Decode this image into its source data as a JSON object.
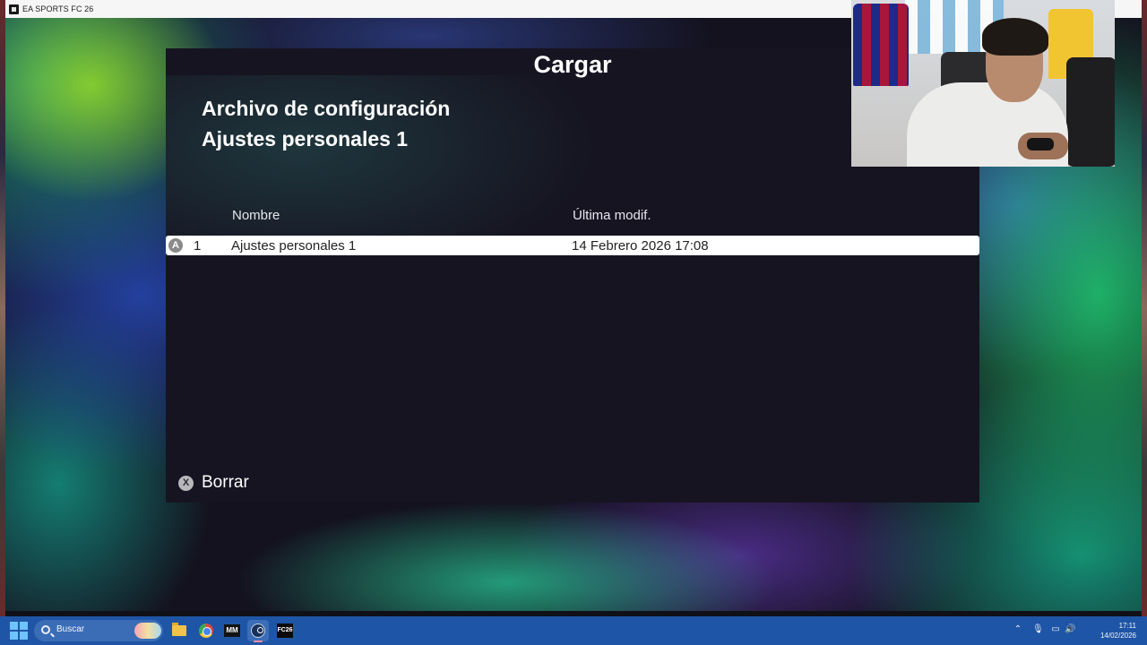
{
  "window": {
    "title": "EA SPORTS FC 26"
  },
  "dialog": {
    "title": "Cargar",
    "file_type": "Archivo de configuración",
    "file_name": "Ajustes personales 1",
    "columns": {
      "name": "Nombre",
      "modified": "Última modif."
    },
    "rows": [
      {
        "button": "A",
        "index": "1",
        "name": "Ajustes personales 1",
        "modified": "14 Febrero 2026 17:08"
      }
    ],
    "actions": {
      "delete_button": "X",
      "delete_label": "Borrar"
    }
  },
  "taskbar": {
    "search_placeholder": "Buscar",
    "apps": [
      {
        "name": "file-explorer-icon"
      },
      {
        "name": "chrome-icon"
      },
      {
        "name": "mm-icon",
        "label": "MM"
      },
      {
        "name": "steam-icon"
      },
      {
        "name": "fc26-icon",
        "label": "FC26"
      }
    ],
    "tray": {
      "time": "17:11",
      "date": "14/02/2026"
    }
  },
  "colors": {
    "dialog_bg": "#161421",
    "row_highlight": "#ffffff",
    "taskbar": "#1f55a6"
  }
}
